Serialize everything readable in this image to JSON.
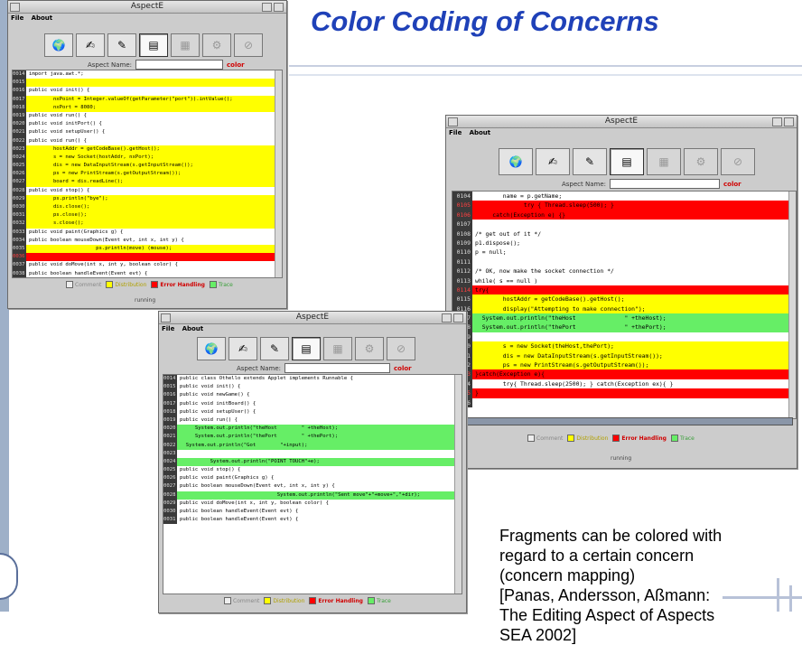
{
  "slide": {
    "title": "Color Coding of Concerns",
    "caption_lines": [
      "Fragments can be colored with",
      "regard to a certain concern",
      "(concern mapping)",
      "[Panas, Andersson, Aßmann:",
      "The Editing Aspect of Aspects",
      "SEA 2002]"
    ]
  },
  "colors": {
    "title": "#1f41b8",
    "yellow": "#ffff00",
    "red": "#ff0000",
    "green": "#66ee66"
  },
  "windows": [
    {
      "id": "win1",
      "title": "AspectE",
      "menu": [
        "File",
        "About"
      ],
      "aspect_name_label": "Aspect Name:",
      "aspect_name_value": "",
      "color_button": "color",
      "legend": [
        "Comment",
        "Distribution",
        "Error Handling",
        "Trace"
      ],
      "status": "running",
      "lines": [
        {
          "n": "0014",
          "c": "w",
          "t": "import java.awt.*;"
        },
        {
          "n": "0015",
          "c": "y",
          "t": ""
        },
        {
          "n": "0016",
          "c": "w",
          "t": "public void init() {"
        },
        {
          "n": "0017",
          "c": "y",
          "t": "        nxPoint = Integer.valueOf(getParameter(\"port\")).intValue();"
        },
        {
          "n": "0018",
          "c": "y",
          "t": "        nxPort = 8080;"
        },
        {
          "n": "0019",
          "c": "w",
          "t": "public void run() {"
        },
        {
          "n": "0020",
          "c": "w",
          "t": "public void initPort() {"
        },
        {
          "n": "0021",
          "c": "w",
          "t": "public void setupUser() {"
        },
        {
          "n": "0022",
          "c": "w",
          "t": "public void run() {"
        },
        {
          "n": "0023",
          "c": "y",
          "t": "        hostAddr = getCodeBase().getHost();"
        },
        {
          "n": "0024",
          "c": "y",
          "t": "        s = new Socket(hostAddr, nxPort);"
        },
        {
          "n": "0025",
          "c": "y",
          "t": "        dis = new DataInputStream(s.getInputStream());"
        },
        {
          "n": "0026",
          "c": "y",
          "t": "        ps = new PrintStream(s.getOutputStream());"
        },
        {
          "n": "0027",
          "c": "y",
          "t": "        board = dis.readLine();"
        },
        {
          "n": "0028",
          "c": "w",
          "t": "public void stop() {"
        },
        {
          "n": "0029",
          "c": "y",
          "t": "        ps.println(\"bye\");"
        },
        {
          "n": "0030",
          "c": "y",
          "t": "        dis.close();"
        },
        {
          "n": "0031",
          "c": "y",
          "t": "        ps.close();"
        },
        {
          "n": "0032",
          "c": "y",
          "t": "        s.close();"
        },
        {
          "n": "0033",
          "c": "w",
          "t": "public void paint(Graphics g) {"
        },
        {
          "n": "0034",
          "c": "w",
          "t": "public boolean mouseDown(Event evt, int x, int y) {"
        },
        {
          "n": "0035",
          "c": "y",
          "t": "                      ps.println(move) (mouse);"
        },
        {
          "n": "0036",
          "c": "r",
          "t": ""
        },
        {
          "n": "0037",
          "c": "w",
          "t": "public void doMove(int x, int y, boolean color) {"
        },
        {
          "n": "0038",
          "c": "w",
          "t": "public boolean handleEvent(Event evt) {"
        }
      ]
    },
    {
      "id": "win2",
      "title": "AspectE",
      "menu": [
        "File",
        "About"
      ],
      "aspect_name_label": "Aspect Name:",
      "aspect_name_value": "",
      "color_button": "color",
      "legend": [
        "Comment",
        "Distribution",
        "Error Handling",
        "Trace"
      ],
      "status": "running",
      "lines": [
        {
          "n": "0014",
          "c": "w",
          "t": "public class Othello extends Applet implements Runnable {"
        },
        {
          "n": "0015",
          "c": "w",
          "t": "public void init() {"
        },
        {
          "n": "0016",
          "c": "w",
          "t": "public void newGame() {"
        },
        {
          "n": "0017",
          "c": "w",
          "t": "public void initBoard() {"
        },
        {
          "n": "0018",
          "c": "w",
          "t": "public void setupUser() {"
        },
        {
          "n": "0019",
          "c": "w",
          "t": "public void run() {"
        },
        {
          "n": "0020",
          "c": "g",
          "t": "     System.out.println(\"theHost        \" +theHost);"
        },
        {
          "n": "0021",
          "c": "g",
          "t": "     System.out.println(\"thePort        \" +thePort);"
        },
        {
          "n": "0022",
          "c": "g",
          "t": "  System.out.println(\"Got        \"+input);"
        },
        {
          "n": "0023",
          "c": "w",
          "t": ""
        },
        {
          "n": "0024",
          "c": "g",
          "t": "          System.out.println(\"POINT TOUCH\"+e);"
        },
        {
          "n": "0025",
          "c": "w",
          "t": "public void stop() {"
        },
        {
          "n": "0026",
          "c": "w",
          "t": "public void paint(Graphics g) {"
        },
        {
          "n": "0027",
          "c": "w",
          "t": "public boolean mouseDown(Event evt, int x, int y) {"
        },
        {
          "n": "0028",
          "c": "g",
          "t": "                                System.out.println(\"Sent move\"+\"+move+\",\"+dir);"
        },
        {
          "n": "0029",
          "c": "w",
          "t": "public void doMove(int x, int y, boolean color) {"
        },
        {
          "n": "0030",
          "c": "w",
          "t": "public boolean handleEvent(Event evt) {"
        },
        {
          "n": "0031",
          "c": "w",
          "t": "public boolean handleEvent(Event evt) {"
        }
      ]
    },
    {
      "id": "win3",
      "title": "AspectE",
      "menu": [
        "File",
        "About"
      ],
      "aspect_name_label": "Aspect Name:",
      "aspect_name_value": "",
      "color_button": "color",
      "legend": [
        "Comment",
        "Distribution",
        "Error Handling",
        "Trace"
      ],
      "status": "running",
      "lines": [
        {
          "n": "0104",
          "c": "w",
          "t": "        name = p.getName;"
        },
        {
          "n": "0105",
          "c": "r",
          "t": "              try { Thread.sleep(500); }"
        },
        {
          "n": "0106",
          "c": "r",
          "t": "     catch(Exception e) {}"
        },
        {
          "n": "0107",
          "c": "w",
          "t": ""
        },
        {
          "n": "0108",
          "c": "w",
          "t": "/* get out of it */"
        },
        {
          "n": "0109",
          "c": "w",
          "t": "p1.dispose();"
        },
        {
          "n": "0110",
          "c": "w",
          "t": "p = null;"
        },
        {
          "n": "0111",
          "c": "w",
          "t": ""
        },
        {
          "n": "0112",
          "c": "w",
          "t": "/* OK, now make the socket connection */"
        },
        {
          "n": "0113",
          "c": "w",
          "t": "while( s == null )"
        },
        {
          "n": "0114",
          "c": "r",
          "t": "try{"
        },
        {
          "n": "0115",
          "c": "y",
          "t": "        hostAddr = getCodeBase().getHost();"
        },
        {
          "n": "0116",
          "c": "y",
          "t": "        display(\"Attempting to make connection\");"
        },
        {
          "n": "0117",
          "c": "g",
          "t": "  System.out.println(\"theHost              \" +theHost);"
        },
        {
          "n": "0118",
          "c": "g",
          "t": "  System.out.println(\"thePort              \" +thePort);"
        },
        {
          "n": "0119",
          "c": "w",
          "t": ""
        },
        {
          "n": "0120",
          "c": "y",
          "t": "        s = new Socket(theHost,thePort);"
        },
        {
          "n": "0121",
          "c": "y",
          "t": "        dis = new DataInputStream(s.getInputStream());"
        },
        {
          "n": "0122",
          "c": "y",
          "t": "        ps = new PrintStream(s.getOutputStream());"
        },
        {
          "n": "0123",
          "c": "r",
          "t": "}catch(Exception e){"
        },
        {
          "n": "0124",
          "c": "w",
          "t": "        try{ Thread.sleep(2500); } catch(Exception ex){ }"
        },
        {
          "n": "0125",
          "c": "r",
          "t": "}"
        },
        {
          "n": "0126",
          "c": "w",
          "t": ""
        }
      ]
    }
  ]
}
